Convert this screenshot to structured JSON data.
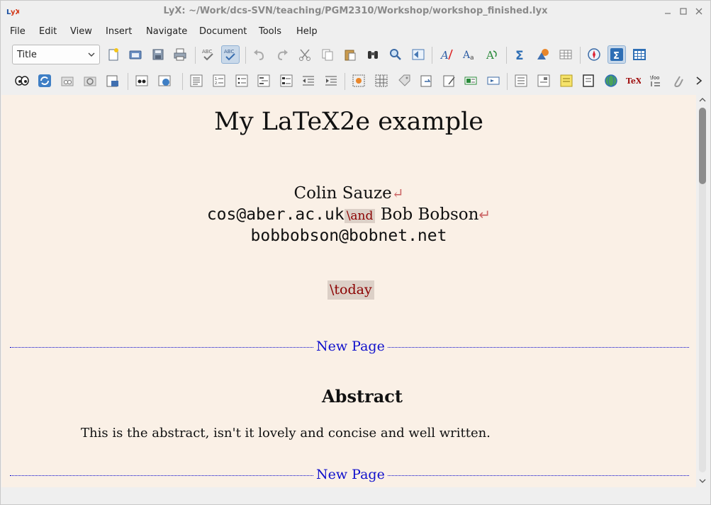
{
  "window": {
    "title": "LyX: ~/Work/dcs-SVN/teaching/PGM2310/Workshop/workshop_finished.lyx",
    "buttons": [
      "minimize-icon",
      "maximize-icon",
      "close-icon"
    ]
  },
  "menubar": {
    "items": [
      "File",
      "Edit",
      "View",
      "Insert",
      "Navigate",
      "Document",
      "Tools",
      "Help"
    ]
  },
  "toolbar": {
    "layout_select": "Title",
    "row1_icons": [
      "new-document-icon",
      "open-document-icon",
      "save-icon",
      "print-icon",
      "spellcheck-icon",
      "continuous-spellcheck-icon",
      "undo-icon",
      "redo-icon",
      "cut-icon",
      "copy-icon",
      "paste-icon",
      "find-icon",
      "find-replace-icon",
      "navigate-back-icon",
      "text-style-icon",
      "apply-font-icon",
      "change-tracking-icon",
      "math-icon",
      "insert-graphics-icon",
      "insert-table-icon",
      "navigator-icon",
      "math-macro-icon",
      "table-icon"
    ],
    "row2_icons": [
      "view-icon",
      "update-icon",
      "view-other-icon",
      "update-other-icon",
      "export-icon",
      "master-view-icon",
      "master-update-icon",
      "standard-layout-icon",
      "enumerate-icon",
      "itemize-icon",
      "description-icon",
      "list-icon",
      "decrease-depth-icon",
      "increase-depth-icon",
      "float-figure-icon",
      "float-table-icon",
      "label-icon",
      "cross-reference-icon",
      "citation-icon",
      "index-entry-icon",
      "footnote-icon",
      "margin-note-icon",
      "note-icon",
      "box-icon",
      "hyperlink-icon",
      "tex-code-icon",
      "branch-icon",
      "attachment-icon",
      "more-icon"
    ]
  },
  "document": {
    "title": "My LaTeX2e example",
    "author_name": "Colin Sauze",
    "author_email": "cos@aber.ac.uk",
    "and_command": "\\and",
    "second_author": "Bob Bobson",
    "second_email": "bobbobson@bobnet.net",
    "date_command": "\\today",
    "newpage_label_1": "New Page",
    "abstract_heading": "Abstract",
    "abstract_text": "This is the abstract, isn't it lovely and concise and well written.",
    "newpage_label_2": "New Page"
  },
  "colors": {
    "page_background": "#faf0e6",
    "ert_text": "#8b0000",
    "ert_background": "#dcd0c7",
    "newpage_color": "#1010cc"
  }
}
